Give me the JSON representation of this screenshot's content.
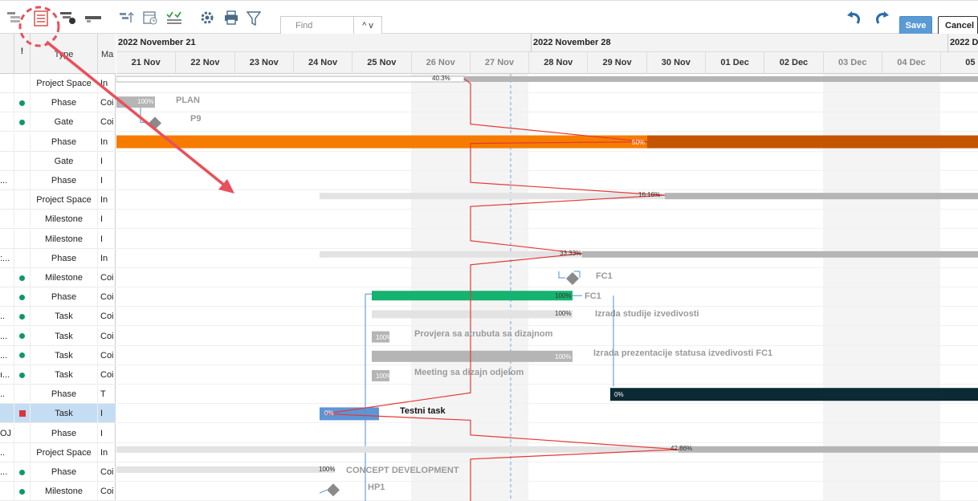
{
  "toolbar": {
    "find_placeholder": "Find",
    "find_nav": "^ v",
    "save_label": "Save",
    "cancel_label": "Cancel"
  },
  "grid": {
    "header_type": "Type",
    "header_m": "Ma",
    "header_flag": "!",
    "rows": [
      {
        "a": "",
        "status": "",
        "type": "Project Space",
        "m": "In"
      },
      {
        "a": "",
        "status": "green",
        "type": "Phase",
        "m": "Coi"
      },
      {
        "a": "",
        "status": "green",
        "type": "Gate",
        "m": "Coi"
      },
      {
        "a": "",
        "status": "",
        "type": "Phase",
        "m": "In"
      },
      {
        "a": "",
        "status": "",
        "type": "Gate",
        "m": "I"
      },
      {
        "a": "...",
        "status": "",
        "type": "Phase",
        "m": "I"
      },
      {
        "a": "",
        "status": "",
        "type": "Project Space",
        "m": "In"
      },
      {
        "a": "",
        "status": "",
        "type": "Milestone",
        "m": "I"
      },
      {
        "a": "",
        "status": "",
        "type": "Milestone",
        "m": "I"
      },
      {
        "a": ":...",
        "status": "",
        "type": "Phase",
        "m": "In"
      },
      {
        "a": "",
        "status": "green",
        "type": "Milestone",
        "m": "Coi"
      },
      {
        "a": "",
        "status": "green",
        "type": "Phase",
        "m": "Coi"
      },
      {
        "a": "..",
        "status": "green",
        "type": "Task",
        "m": "Coi"
      },
      {
        "a": "...",
        "status": "green",
        "type": "Task",
        "m": "Coi"
      },
      {
        "a": "...",
        "status": "green",
        "type": "Task",
        "m": "Coi"
      },
      {
        "a": "ı...",
        "status": "green",
        "type": "Task",
        "m": "Coi"
      },
      {
        "a": "..",
        "status": "",
        "type": "Phase",
        "m": "T"
      },
      {
        "a": "",
        "status": "red",
        "type": "Task",
        "m": "I"
      },
      {
        "a": "OJ",
        "status": "",
        "type": "Phase",
        "m": "I"
      },
      {
        "a": "..",
        "status": "",
        "type": "Project Space",
        "m": "In"
      },
      {
        "a": "...",
        "status": "green",
        "type": "Phase",
        "m": "Coi"
      },
      {
        "a": "",
        "status": "green",
        "type": "Milestone",
        "m": "Coi"
      }
    ]
  },
  "timeline": {
    "weeks": [
      "2022 November 21",
      "2022 November 28",
      "2022 D"
    ],
    "days": [
      "21 Nov",
      "22 Nov",
      "23 Nov",
      "24 Nov",
      "25 Nov",
      "26 Nov",
      "27 Nov",
      "28 Nov",
      "29 Nov",
      "30 Nov",
      "01 Dec",
      "02 Dec",
      "03 Dec",
      "04 Dec",
      "05"
    ],
    "weekend_days": [
      5,
      6,
      12,
      13
    ],
    "today_marker": "27 Nov"
  },
  "gantt": {
    "labels": {
      "plan": "PLAN",
      "p9": "P9",
      "fc1_milestone": "FC1",
      "fc1_phase": "FC1",
      "izrada_studije": "Izrada studije izvedivosti",
      "provjera": "Provjera sa atrubuta sa dizajnom",
      "izrada_prezentacije": "Izrada prezentacije statusa izvedivosti FC1",
      "meeting": "Meeting sa dizajn odjelom",
      "testni_task": "Testni task",
      "concept": "CONCEPT DEVELOPMENT",
      "hp1": "HP1"
    },
    "percents": {
      "r0": "40.3%",
      "r1": "100%",
      "r3": "50%",
      "r6": "16.16%",
      "r9": "33.33%",
      "r11": "100%",
      "r12": "100%",
      "r13": "100%",
      "r14": "100%",
      "r15": "100%",
      "r16": "0%",
      "r17": "0%",
      "r19": "42.86%",
      "r20": "100%"
    },
    "colors": {
      "orange": "#f57c00",
      "dark_orange": "#c45500",
      "green": "#16b26f",
      "dark_teal": "#0b2a33",
      "task_blue": "#5d95d6",
      "gray_bar": "#b5b5b5",
      "light_bar": "#e3e3e3",
      "critical_line": "#e53935",
      "annotation": "#e8505b"
    }
  }
}
